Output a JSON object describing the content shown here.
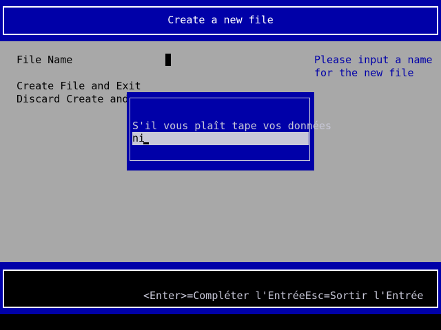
{
  "header": {
    "title": "Create a new file"
  },
  "form": {
    "file_name_label": "File Name",
    "create_label": "Create File and Exit",
    "discard_label": "Discard Create and Exit"
  },
  "help": {
    "line1": "Please input a name",
    "line2": "for the new file"
  },
  "dialog": {
    "prompt": "S'il vous plaît tape vos données",
    "input_value": "ni"
  },
  "footer": {
    "hint": "<Enter>=Compléter l'EntréeEsc=Sortir l'Entrée"
  },
  "colors": {
    "background": "#a8a8a8",
    "blue": "#0000a8",
    "light": "#c8c8d8"
  }
}
